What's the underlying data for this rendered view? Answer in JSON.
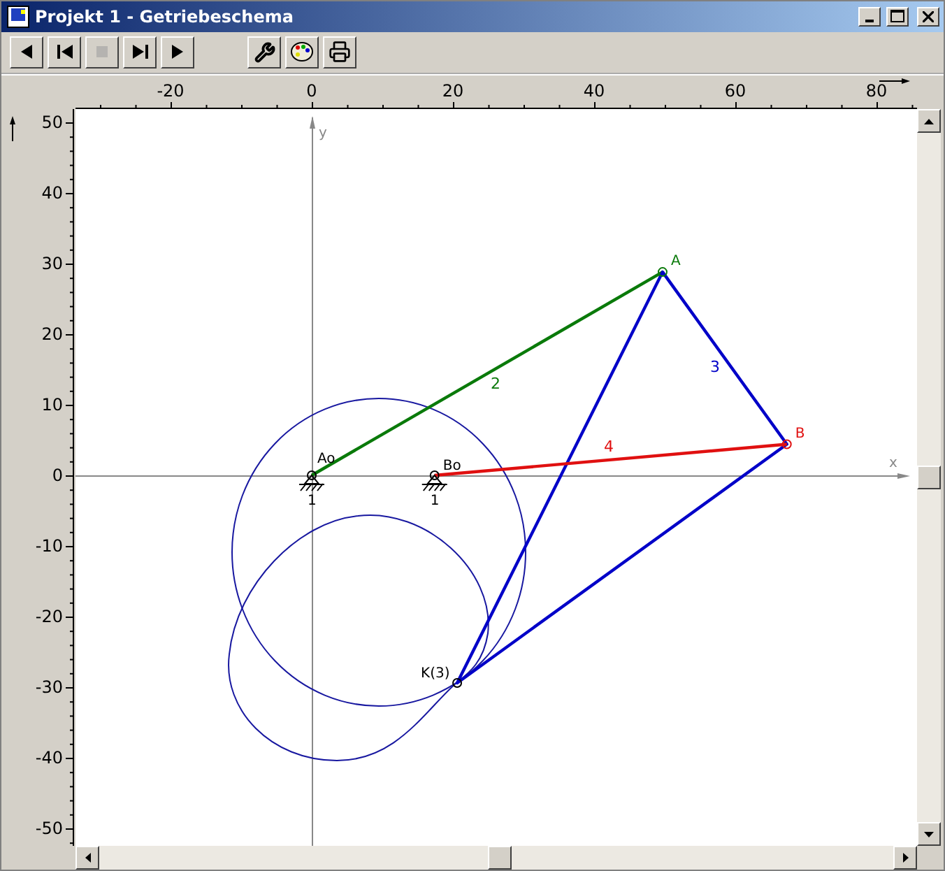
{
  "window": {
    "title": "Projekt 1 - Getriebeschema"
  },
  "toolbar": {
    "playback": [
      {
        "kind": "back",
        "disabled": false
      },
      {
        "kind": "first",
        "disabled": false
      },
      {
        "kind": "stop",
        "disabled": true
      },
      {
        "kind": "last",
        "disabled": false
      },
      {
        "kind": "play",
        "disabled": false
      }
    ],
    "tools": [
      {
        "kind": "settings"
      },
      {
        "kind": "colors"
      },
      {
        "kind": "print"
      }
    ]
  },
  "rulers": {
    "x_ticks": [
      "-20",
      "0",
      "20",
      "40",
      "60",
      "80"
    ],
    "y_ticks": [
      "50",
      "40",
      "30",
      "20",
      "10",
      "0",
      "-10",
      "-20",
      "-30",
      "-40",
      "-50"
    ]
  },
  "plot": {
    "axis_x_label": "x",
    "axis_y_label": "y",
    "links": [
      {
        "label": "2",
        "color": "#0a7a0a"
      },
      {
        "label": "3",
        "color": "#0000c8"
      },
      {
        "label": "4",
        "color": "#e01010"
      }
    ],
    "joints": [
      {
        "label": "Ao",
        "color": "#000000"
      },
      {
        "label": "Bo",
        "color": "#000000"
      },
      {
        "label": "A",
        "color": "#0a7a0a"
      },
      {
        "label": "B",
        "color": "#e01010"
      },
      {
        "label": "K(3)",
        "color": "#000000"
      }
    ],
    "ground_labels": [
      "1",
      "1"
    ]
  }
}
